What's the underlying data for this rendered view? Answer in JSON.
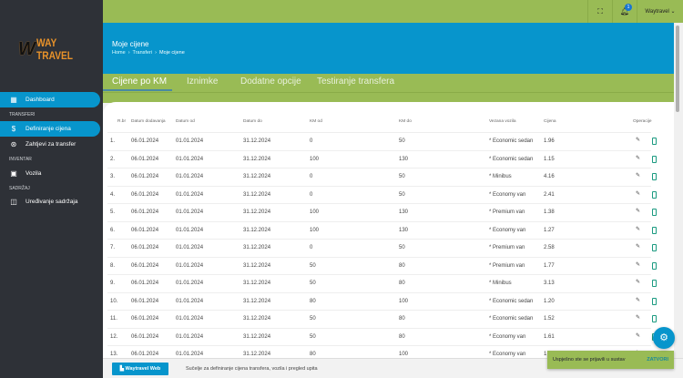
{
  "logo": {
    "text": "WAY TRAVEL",
    "mark": "W"
  },
  "sidebar": {
    "items": [
      {
        "label": "Dashboard",
        "icon": "dashboard-icon"
      },
      {
        "label": "Definiranje cijena",
        "icon": "dollar-icon"
      },
      {
        "label": "Zahtjevi za transfer",
        "icon": "transfer-icon"
      },
      {
        "label": "Vozila",
        "icon": "car-icon"
      },
      {
        "label": "Uređivanje sadržaja",
        "icon": "content-icon"
      }
    ],
    "sections": [
      "TRANSFERI",
      "INVENTAR",
      "SADRŽAJ"
    ]
  },
  "topbar": {
    "notifications": "1",
    "user": "Waytravel"
  },
  "header": {
    "title": "Moje cijene",
    "breadcrumb": [
      "Home",
      "Transferi",
      "Moje cijene"
    ]
  },
  "tabs": [
    "Cijene po KM",
    "Iznimke",
    "Dodatne opcije",
    "Testiranje transfera"
  ],
  "table": {
    "headers": [
      "R.br",
      "Datum dodavanja",
      "Datum od",
      "Datum do",
      "KM od",
      "KM do",
      "Vezana vozila",
      "Cijena",
      "Operacije"
    ],
    "rows": [
      [
        "1.",
        "06.01.2024",
        "01.01.2024",
        "31.12.2024",
        "0",
        "50",
        "* Economic sedan",
        "1.96"
      ],
      [
        "2.",
        "06.01.2024",
        "01.01.2024",
        "31.12.2024",
        "100",
        "130",
        "* Economic sedan",
        "1.15"
      ],
      [
        "3.",
        "06.01.2024",
        "01.01.2024",
        "31.12.2024",
        "0",
        "50",
        "* Minibus",
        "4.16"
      ],
      [
        "4.",
        "06.01.2024",
        "01.01.2024",
        "31.12.2024",
        "0",
        "50",
        "* Economy van",
        "2.41"
      ],
      [
        "5.",
        "06.01.2024",
        "01.01.2024",
        "31.12.2024",
        "100",
        "130",
        "* Premium van",
        "1.38"
      ],
      [
        "6.",
        "06.01.2024",
        "01.01.2024",
        "31.12.2024",
        "100",
        "130",
        "* Economy van",
        "1.27"
      ],
      [
        "7.",
        "06.01.2024",
        "01.01.2024",
        "31.12.2024",
        "0",
        "50",
        "* Premium van",
        "2.58"
      ],
      [
        "8.",
        "06.01.2024",
        "01.01.2024",
        "31.12.2024",
        "50",
        "80",
        "* Premium van",
        "1.77"
      ],
      [
        "9.",
        "06.01.2024",
        "01.01.2024",
        "31.12.2024",
        "50",
        "80",
        "* Minibus",
        "3.13"
      ],
      [
        "10.",
        "06.01.2024",
        "01.01.2024",
        "31.12.2024",
        "80",
        "100",
        "* Economic sedan",
        "1.20"
      ],
      [
        "11.",
        "06.01.2024",
        "01.01.2024",
        "31.12.2024",
        "50",
        "80",
        "* Economic sedan",
        "1.52"
      ],
      [
        "12.",
        "06.01.2024",
        "01.01.2024",
        "31.12.2024",
        "50",
        "80",
        "* Economy van",
        "1.61"
      ],
      [
        "13.",
        "06.01.2024",
        "01.01.2024",
        "31.12.2024",
        "80",
        "100",
        "* Economy van",
        "1"
      ]
    ]
  },
  "footer": {
    "button": "Waytravel Web",
    "text": "Sučelje za definiranje cijena transfera, vozila i pregled upita"
  },
  "toast": {
    "message": "Uspješno ste se prijavili u sustav",
    "action": "ZATVORI"
  },
  "colors": {
    "green": "#99bb55",
    "blue": "#0795cc",
    "sidebar": "#2e3137",
    "teal": "#1a9a80"
  }
}
